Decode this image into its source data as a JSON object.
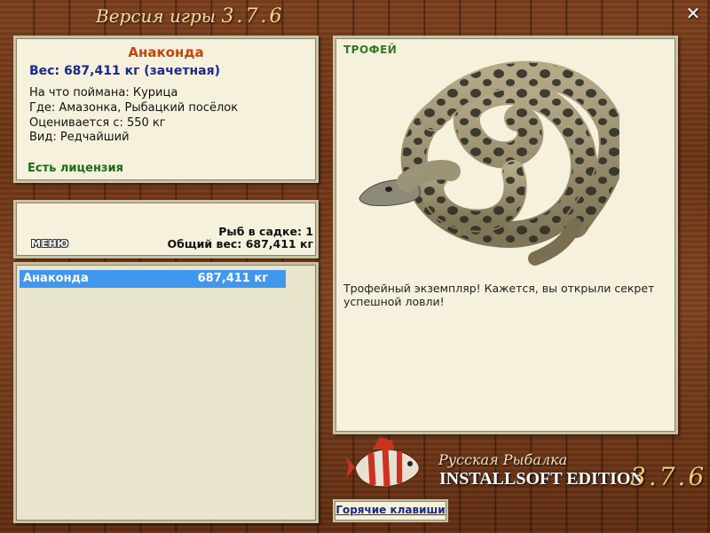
{
  "window": {
    "title_prefix": "Версия игры",
    "title_version": "3.7.6"
  },
  "fish_info": {
    "name": "Анаконда",
    "weight": "Вес: 687,411 кг (зачетная)",
    "lines": [
      "На что поймана: Курица",
      "Где: Амазонка, Рыбацкий посёлок",
      "Оценивается с: 550 кг",
      "Вид: Редчайший"
    ],
    "license": "Есть лицензия"
  },
  "keepnet": {
    "menu_label": "МЕНЮ",
    "count": "Рыб в садке: 1",
    "total_weight": "Общий вес: 687,411 кг"
  },
  "catch_list": [
    {
      "name": "Анаконда",
      "weight": "687,411 кг"
    }
  ],
  "trophy": {
    "label": "ТРОФЕЙ",
    "text": "Трофейный экземпляр! Кажется, вы открыли секрет успешной ловли!"
  },
  "logo": {
    "line1": "Русская Рыбалка",
    "line2": "INSTALLSOFT EDITION",
    "version": "3.7.6"
  },
  "hotkeys_label": "Горячие клавиши",
  "icons": {
    "close": "close-icon",
    "logo_fish": "fish-logo-icon"
  },
  "colors": {
    "panel_bg": "#f6f1dc",
    "fish_name": "#c0440c",
    "weight": "#1a2a8a",
    "license": "#1f6a16",
    "selection": "#3f97ef",
    "trophy_label": "#2f7a22"
  }
}
